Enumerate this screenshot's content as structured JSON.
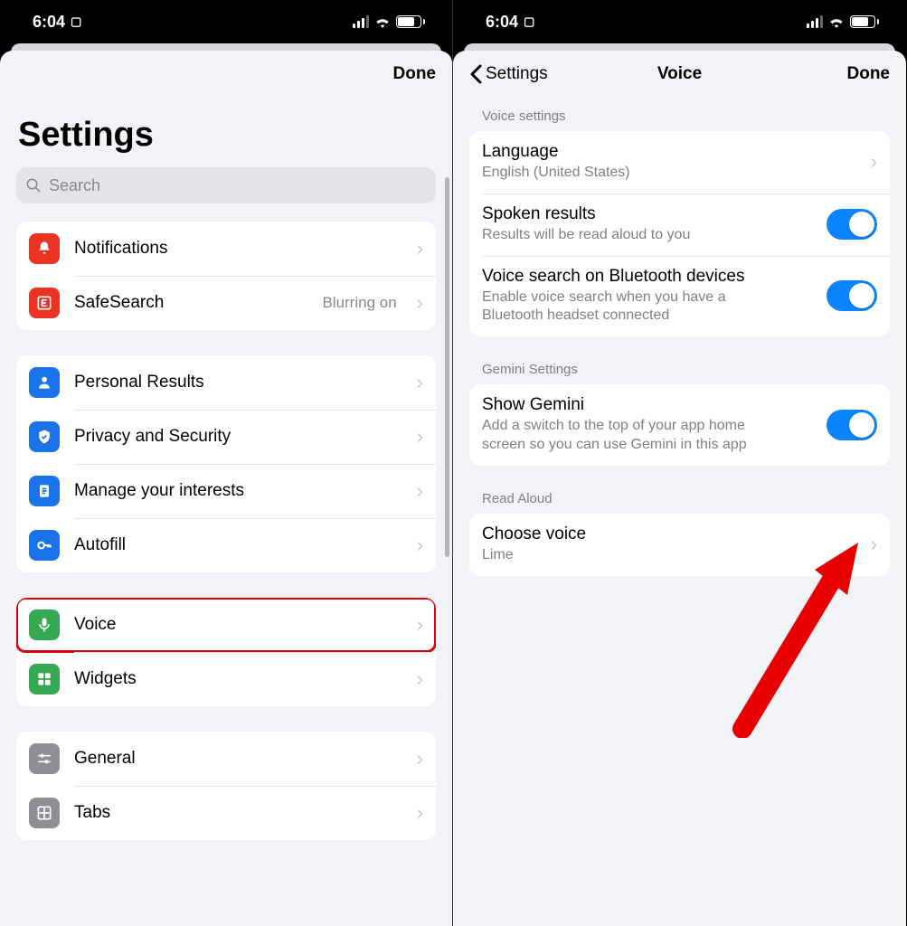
{
  "status": {
    "time": "6:04",
    "battery": "71"
  },
  "left": {
    "done": "Done",
    "title": "Settings",
    "search_placeholder": "Search",
    "groups": [
      [
        {
          "key": "notifications",
          "label": "Notifications",
          "icon": "bell",
          "color": "red"
        },
        {
          "key": "safesearch",
          "label": "SafeSearch",
          "value": "Blurring on",
          "icon": "explicit",
          "color": "red"
        }
      ],
      [
        {
          "key": "personal",
          "label": "Personal Results",
          "icon": "person",
          "color": "blue"
        },
        {
          "key": "privacy",
          "label": "Privacy and Security",
          "icon": "shield",
          "color": "blue"
        },
        {
          "key": "interests",
          "label": "Manage your interests",
          "icon": "doc",
          "color": "blue"
        },
        {
          "key": "autofill",
          "label": "Autofill",
          "icon": "key",
          "color": "blue"
        }
      ],
      [
        {
          "key": "voice",
          "label": "Voice",
          "icon": "mic",
          "color": "green",
          "highlight": true
        },
        {
          "key": "widgets",
          "label": "Widgets",
          "icon": "widgets",
          "color": "green"
        }
      ],
      [
        {
          "key": "general",
          "label": "General",
          "icon": "sliders",
          "color": "gray"
        },
        {
          "key": "tabs",
          "label": "Tabs",
          "icon": "grid",
          "color": "gray"
        }
      ]
    ]
  },
  "right": {
    "back": "Settings",
    "title": "Voice",
    "done": "Done",
    "sections": [
      {
        "header": "Voice settings",
        "rows": [
          {
            "key": "language",
            "label": "Language",
            "sub": "English (United States)",
            "type": "nav"
          },
          {
            "key": "spoken",
            "label": "Spoken results",
            "sub": "Results will be read aloud to you",
            "type": "toggle",
            "on": true
          },
          {
            "key": "bt",
            "label": "Voice search on Bluetooth devices",
            "sub": "Enable voice search when you have a Bluetooth headset connected",
            "type": "toggle",
            "on": true
          }
        ]
      },
      {
        "header": "Gemini Settings",
        "rows": [
          {
            "key": "gemini",
            "label": "Show Gemini",
            "sub": "Add a switch to the top of your app home screen so you can use Gemini in this app",
            "type": "toggle",
            "on": true
          }
        ]
      },
      {
        "header": "Read Aloud",
        "rows": [
          {
            "key": "choose",
            "label": "Choose voice",
            "sub": "Lime",
            "type": "nav"
          }
        ]
      }
    ]
  }
}
